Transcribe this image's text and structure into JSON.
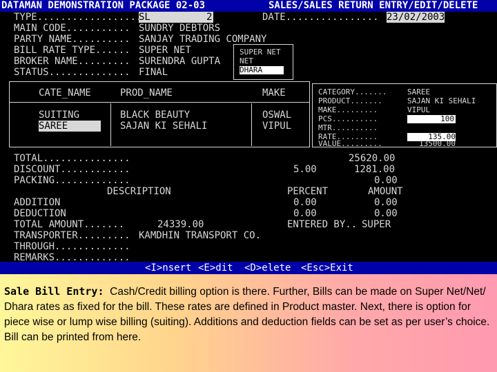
{
  "header": {
    "app_title": "DATAMAN DEMONSTRATION PACKAGE 02-03",
    "screen_title": "SALES/SALES RETURN ENTRY/EDIT/DELETE"
  },
  "form": {
    "type_label": "TYPE..................",
    "type_value": "SL",
    "type_number": "2",
    "date_label": "DATE................",
    "date_value": "23/02/2003",
    "main_code_label": "MAIN CODE...........",
    "main_code_value": "SUNDRY DEBTORS",
    "party_label": "PARTY NAME..........",
    "party_value": "SANJAY TRADING COMPANY",
    "bill_rate_label": "BILL RATE TYPE......",
    "bill_rate_value": "SUPER NET",
    "broker_label": "BROKER NAME.........",
    "broker_value": "SURENDRA GUPTA",
    "status_label": "STATUS..............",
    "status_value": "FINAL"
  },
  "rate_popup": {
    "options": [
      "SUPER NET",
      "NET",
      "DHARA"
    ],
    "selected_index": 2
  },
  "items": {
    "columns": [
      "CATE_NAME",
      "PROD_NAME",
      "MAKE"
    ],
    "rows": [
      {
        "cate": "SUITING",
        "prod": "BLACK BEAUTY",
        "make": "OSWAL"
      },
      {
        "cate": "SAREE",
        "prod": "SAJAN KI SEHALI",
        "make": "VIPUL"
      }
    ],
    "selected_row": 1
  },
  "detail": {
    "category_label": "CATEGORY.......",
    "category_value": "SAREE",
    "product_label": "PRODUCT.......",
    "product_value": "SAJAN KI SEHALI",
    "make_label": "MAKE.........",
    "make_value": "VIPUL",
    "pcs_label": "PCS..........",
    "pcs_value": "100",
    "mtr_label": "MTR..........",
    "mtr_value": "",
    "rate_label": "RATE.........",
    "rate_value": "135.00",
    "value_label": "VALUE.........",
    "value_value": "13500.00"
  },
  "totals": {
    "total_label": "TOTAL...............",
    "total_value": "25620.00",
    "discount_label": "DISCOUNT............",
    "discount_percent": "5.00",
    "discount_value": "1281.00",
    "packing_label": "PACKING.............",
    "packing_value": "0.00",
    "description_header": "DESCRIPTION",
    "percent_header": "PERCENT",
    "amount_header": "AMOUNT",
    "addition_label": "ADDITION",
    "addition_percent": "0.00",
    "addition_amount": "0.00",
    "deduction_label": "DEDUCTION",
    "deduction_percent": "0.00",
    "deduction_amount": "0.00",
    "total_amount_label": "TOTAL AMOUNT.......",
    "total_amount_value": "24339.00",
    "entered_by_label": "ENTERED BY..",
    "entered_by_value": "SUPER",
    "transporter_label": "TRANSPORTER.........",
    "transporter_value": "KAMDHIN TRANSPORT CO.",
    "through_label": "THROUGH.............",
    "remarks_label": "REMARKS............."
  },
  "statusbar": {
    "insert": "<I>nsert",
    "edit": "<E>dit",
    "delete": "<D>elete",
    "escape": "<Esc>Exit"
  },
  "caption": {
    "lead": "Sale Bill Entry:",
    "text": "Cash/Credit  billing option  is  there.  Further, Bills can be made on Super Net/Net/ Dhara  rates  as  fixed  for  the  bill. These rates are defined in Product master. Next, there is option for  piece wise or lump wise billing  (suiting).  Additions and deduction fields can be set as per user’s choice. Bill can be printed  from here."
  }
}
